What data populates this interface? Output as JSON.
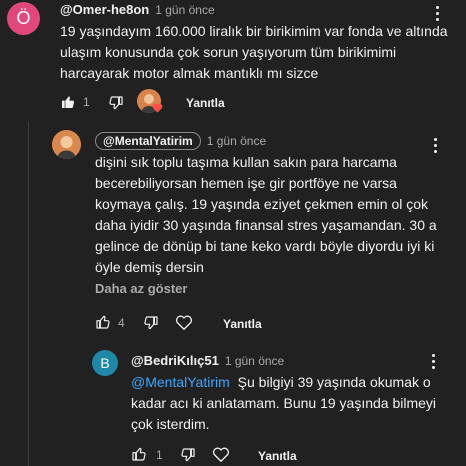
{
  "comment1": {
    "avatar_letter": "Ö",
    "avatar_color": "#e2477c",
    "handle": "@Omer-he8on",
    "time": "1 gün önce",
    "text_lines": [
      "19 yaşındayım 160.000 liralık bir birikimim var fonda ve altında",
      "ulaşım konusunda çok sorun yaşıyorum tüm birikimimi",
      "harcayarak motor almak mantıklı mı sizce"
    ],
    "like_count": "1",
    "reply_label": "Yanıtla"
  },
  "comment2": {
    "handle": "@MentalYatirim",
    "time": "1 gün önce",
    "text_lines": [
      "dişini sık toplu taşıma kullan sakın para harcama",
      "becerebiliyorsan hemen işe gir portföye ne varsa",
      "koymaya çalış. 19 yaşında eziyet çekmen emin ol çok",
      "daha iyidir 30 yaşında finansal stres yaşamandan. 30 a",
      "gelince de dönüp bi tane keko vardı böyle diyordu iyi ki",
      "öyle demiş dersin"
    ],
    "show_less": "Daha az göster",
    "like_count": "4",
    "reply_label": "Yanıtla"
  },
  "comment3": {
    "avatar_letter": "B",
    "avatar_color": "#1e88a8",
    "handle": "@BedriKılıç51",
    "time": "1 gün önce",
    "mention": "@MentalYatirim",
    "text_first": "Şu bilgiyi 39 yaşında okumak o",
    "text_lines": [
      "kadar acı ki anlatamam. Bunu 19 yaşında bilmeyi",
      "çok isterdim."
    ],
    "like_count": "1",
    "reply_label": "Yanıtla"
  },
  "colors": {
    "background": "#212121",
    "heart": "#ff4e45",
    "link": "#3ea6ff"
  },
  "icons": [
    "like-icon",
    "dislike-icon",
    "heart-icon",
    "more-options-icon"
  ]
}
